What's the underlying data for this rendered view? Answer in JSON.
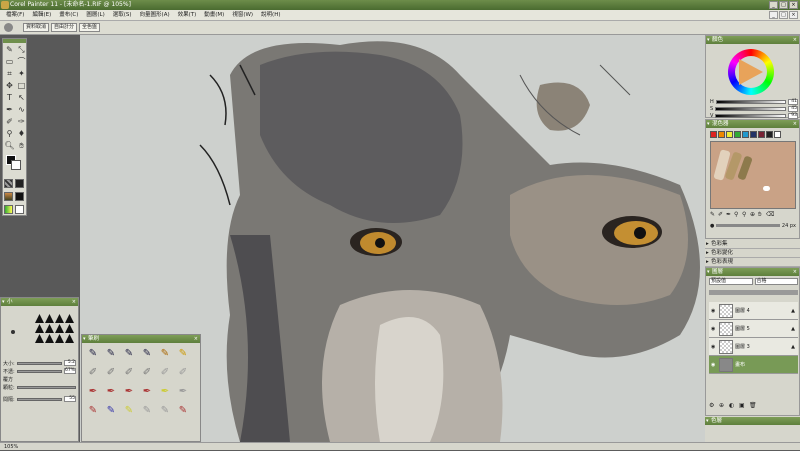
{
  "window": {
    "title": "Corel Painter 11 - [未命名-1.RIF @ 105%]",
    "controls": [
      "_",
      "□",
      "×"
    ]
  },
  "menu": {
    "items": [
      "檔案(F)",
      "編輯(E)",
      "畫布(C)",
      "圖層(L)",
      "選取(S)",
      "向量圖形(A)",
      "效果(T)",
      "動畫(M)",
      "視窗(W)",
      "說明(H)"
    ]
  },
  "propbar": {
    "buttons": [
      "資料取消",
      "自由計分",
      "全色盤"
    ]
  },
  "panels": {
    "color": {
      "title": "顏色",
      "values": [
        "41",
        "45",
        "93"
      ]
    },
    "mixer": {
      "title": "混色器",
      "swatch_colors": [
        "#d22",
        "#e80",
        "#ee3",
        "#3a3",
        "#29c",
        "#236",
        "#723",
        "#222",
        "#fff"
      ],
      "size": "24 px"
    },
    "collapsed": [
      "色彩集",
      "色彩變化",
      "色彩表現"
    ],
    "layers": {
      "title": "圖層",
      "composite": "預設值",
      "opacity": "合格",
      "items": [
        {
          "name": "圖層 4",
          "selected": false
        },
        {
          "name": "圖層 5",
          "selected": false
        },
        {
          "name": "圖層 3",
          "selected": false
        },
        {
          "name": "畫布",
          "selected": true
        }
      ]
    },
    "channels": {
      "title": "色層"
    }
  },
  "brush": {
    "title": "小",
    "sliders": [
      {
        "label": "大小:",
        "value": "5.2"
      },
      {
        "label": "不透:",
        "value": "67%"
      },
      {
        "label": "顆粒:",
        "value": "50"
      }
    ],
    "mode": "覆方",
    "spacing_label": "間隔:",
    "spacing_value": "55"
  },
  "media": {
    "title": "筆刷"
  },
  "status": {
    "zoom": "105%"
  }
}
